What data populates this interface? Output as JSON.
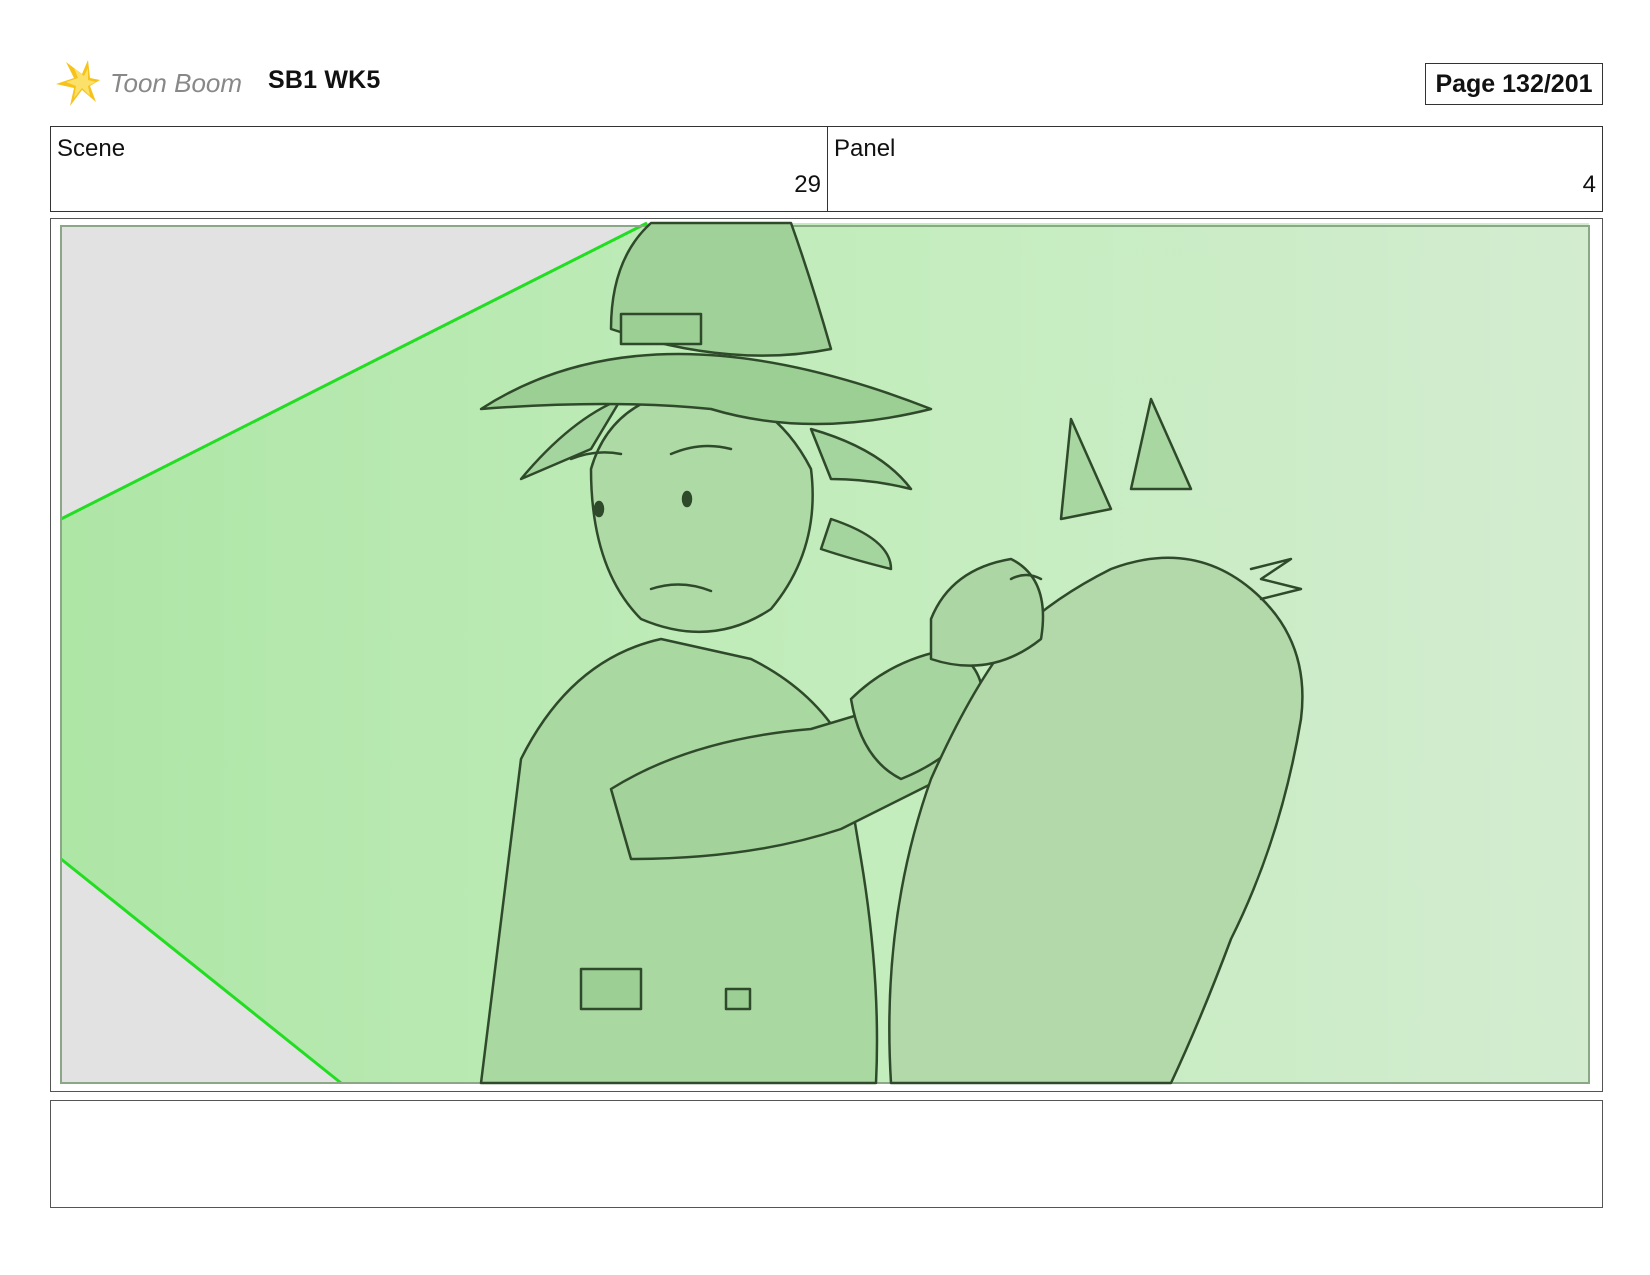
{
  "header": {
    "brand_name": "Toon Boom",
    "project_title": "SB1 WK5",
    "page_label": "Page 132/201"
  },
  "info": {
    "scene_label": "Scene",
    "scene_value": "29",
    "panel_label": "Panel",
    "panel_value": "4"
  },
  "panel": {
    "camera_color": "#22dd22",
    "overlay_color": "#a8e6a0",
    "line_color": "#2f4a2a"
  },
  "caption": {
    "text": ""
  }
}
